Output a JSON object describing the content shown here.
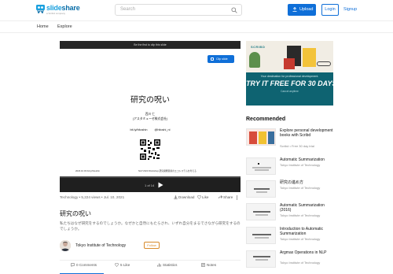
{
  "brand": {
    "name_a": "slide",
    "name_b": "share",
    "tagline": "a Scribd company"
  },
  "header": {
    "search_placeholder": "Search",
    "upload_label": "Upload",
    "login_label": "Login",
    "signup_label": "Signup"
  },
  "nav": {
    "items": [
      "Home",
      "Explore"
    ]
  },
  "player": {
    "top_hint": "Be the first to clip this slide",
    "clip_label": "Clip slide",
    "progress": 0.0,
    "page_indicator": "1 of 14"
  },
  "slide": {
    "title": "研究の呪い",
    "author": "西川 仁",
    "org": "(アスタミューゼ株式会社)",
    "handles": "bit.ly/hitoshin   @hitoshi_ni",
    "foot_left": "2023.10.03 bit.ly/hitoshin",
    "foot_mid": "NLP 2023 Workshop 研究開発環境のエコシステムを考える"
  },
  "meta": {
    "info": "Technology • 5,224 views • Jul. 10, 2021",
    "download": "Download",
    "like": "Like",
    "share": "Share"
  },
  "doc": {
    "title": "研究の呪い",
    "description": "私たちはなぜ研究をするのでしょうか。なぜかと自然にもたらされ、いずれ自分をまるでさながら研究をするのでしょうか。"
  },
  "author": {
    "name": "Tokyo Institute of Technology",
    "follow": "Follow"
  },
  "tabs": [
    {
      "label": "0 Comments",
      "icon": "comment-icon"
    },
    {
      "label": "5 Like",
      "icon": "heart-icon"
    },
    {
      "label": "Statistics",
      "icon": "stats-icon"
    },
    {
      "label": "Notes",
      "icon": "notes-icon"
    }
  ],
  "ad": {
    "brand": "SCRIBD",
    "line1": "Your destination for professional development.",
    "line2": "TRY IT FREE FOR 30 DAYS",
    "line3": "Cancel anytime"
  },
  "recommended": {
    "heading": "Recommended",
    "items": [
      {
        "title": "Explore personal development books with Scribd",
        "sub": "Scribd • Free 30 day trial"
      },
      {
        "title": "Automatic Summarization",
        "sub": "Tokyo Institute of Technology"
      },
      {
        "title": "研究の進め方",
        "sub": "Tokyo Institute of Technology"
      },
      {
        "title": "Automatic Summarization (2016)",
        "sub": "Tokyo Institute of Technology"
      },
      {
        "title": "Introduction to Automatic Summarization",
        "sub": "Tokyo Institute of Technology"
      },
      {
        "title": "Argmax Operations in NLP",
        "sub": "Tokyo Institute of Technology"
      }
    ]
  },
  "colors": {
    "accent": "#0f6fd8",
    "brand": "#1aa0de",
    "follow": "#d88a2a",
    "ad_dark": "#0e6371"
  }
}
